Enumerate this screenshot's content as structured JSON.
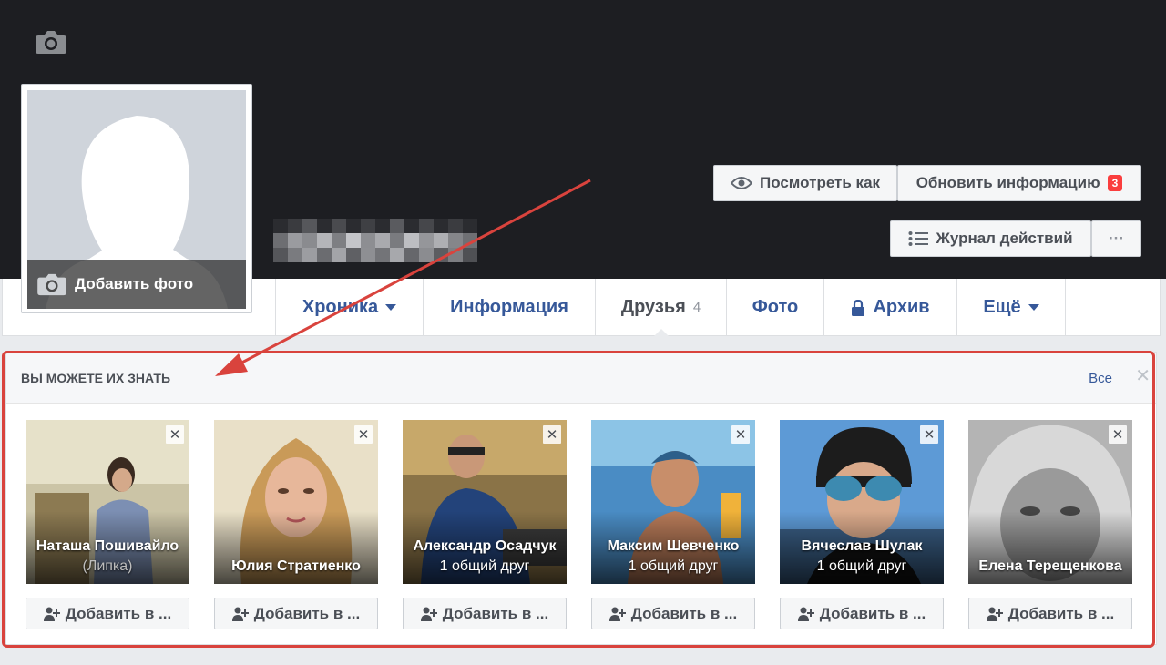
{
  "cover": {
    "camera_icon": "camera-icon"
  },
  "profile": {
    "add_photo_label": "Добавить фото"
  },
  "header_buttons": {
    "view_as": "Посмотреть как",
    "update_info": "Обновить информацию",
    "update_badge": "3",
    "activity_log": "Журнал действий",
    "more_dots": "···"
  },
  "tabs": [
    {
      "label": "Хроника",
      "caret": true
    },
    {
      "label": "Информация"
    },
    {
      "label": "Друзья",
      "count": "4",
      "active": true
    },
    {
      "label": "Фото"
    },
    {
      "label": "Архив",
      "lock": true
    },
    {
      "label": "Ещё",
      "caret": true
    }
  ],
  "pymk": {
    "title": "ВЫ МОЖЕТЕ ИХ ЗНАТЬ",
    "see_all": "Все",
    "close": "✕",
    "add_button_label": "Добавить в ...",
    "card_close": "✕",
    "people": [
      {
        "name": "Наташа Пошивайло",
        "sub": "(Липка)",
        "sub_dim": true
      },
      {
        "name": "Юлия Стратиенко",
        "sub": ""
      },
      {
        "name": "Александр Осадчук",
        "sub": "1 общий друг"
      },
      {
        "name": "Максим Шевченко",
        "sub": "1 общий друг"
      },
      {
        "name": "Вячеслав Шулак",
        "sub": "1 общий друг"
      },
      {
        "name": "Елена Терещенкова",
        "sub": ""
      }
    ]
  },
  "colors": {
    "accent": "#365899",
    "badge": "#fa3e3e",
    "highlight": "#d9433d"
  }
}
